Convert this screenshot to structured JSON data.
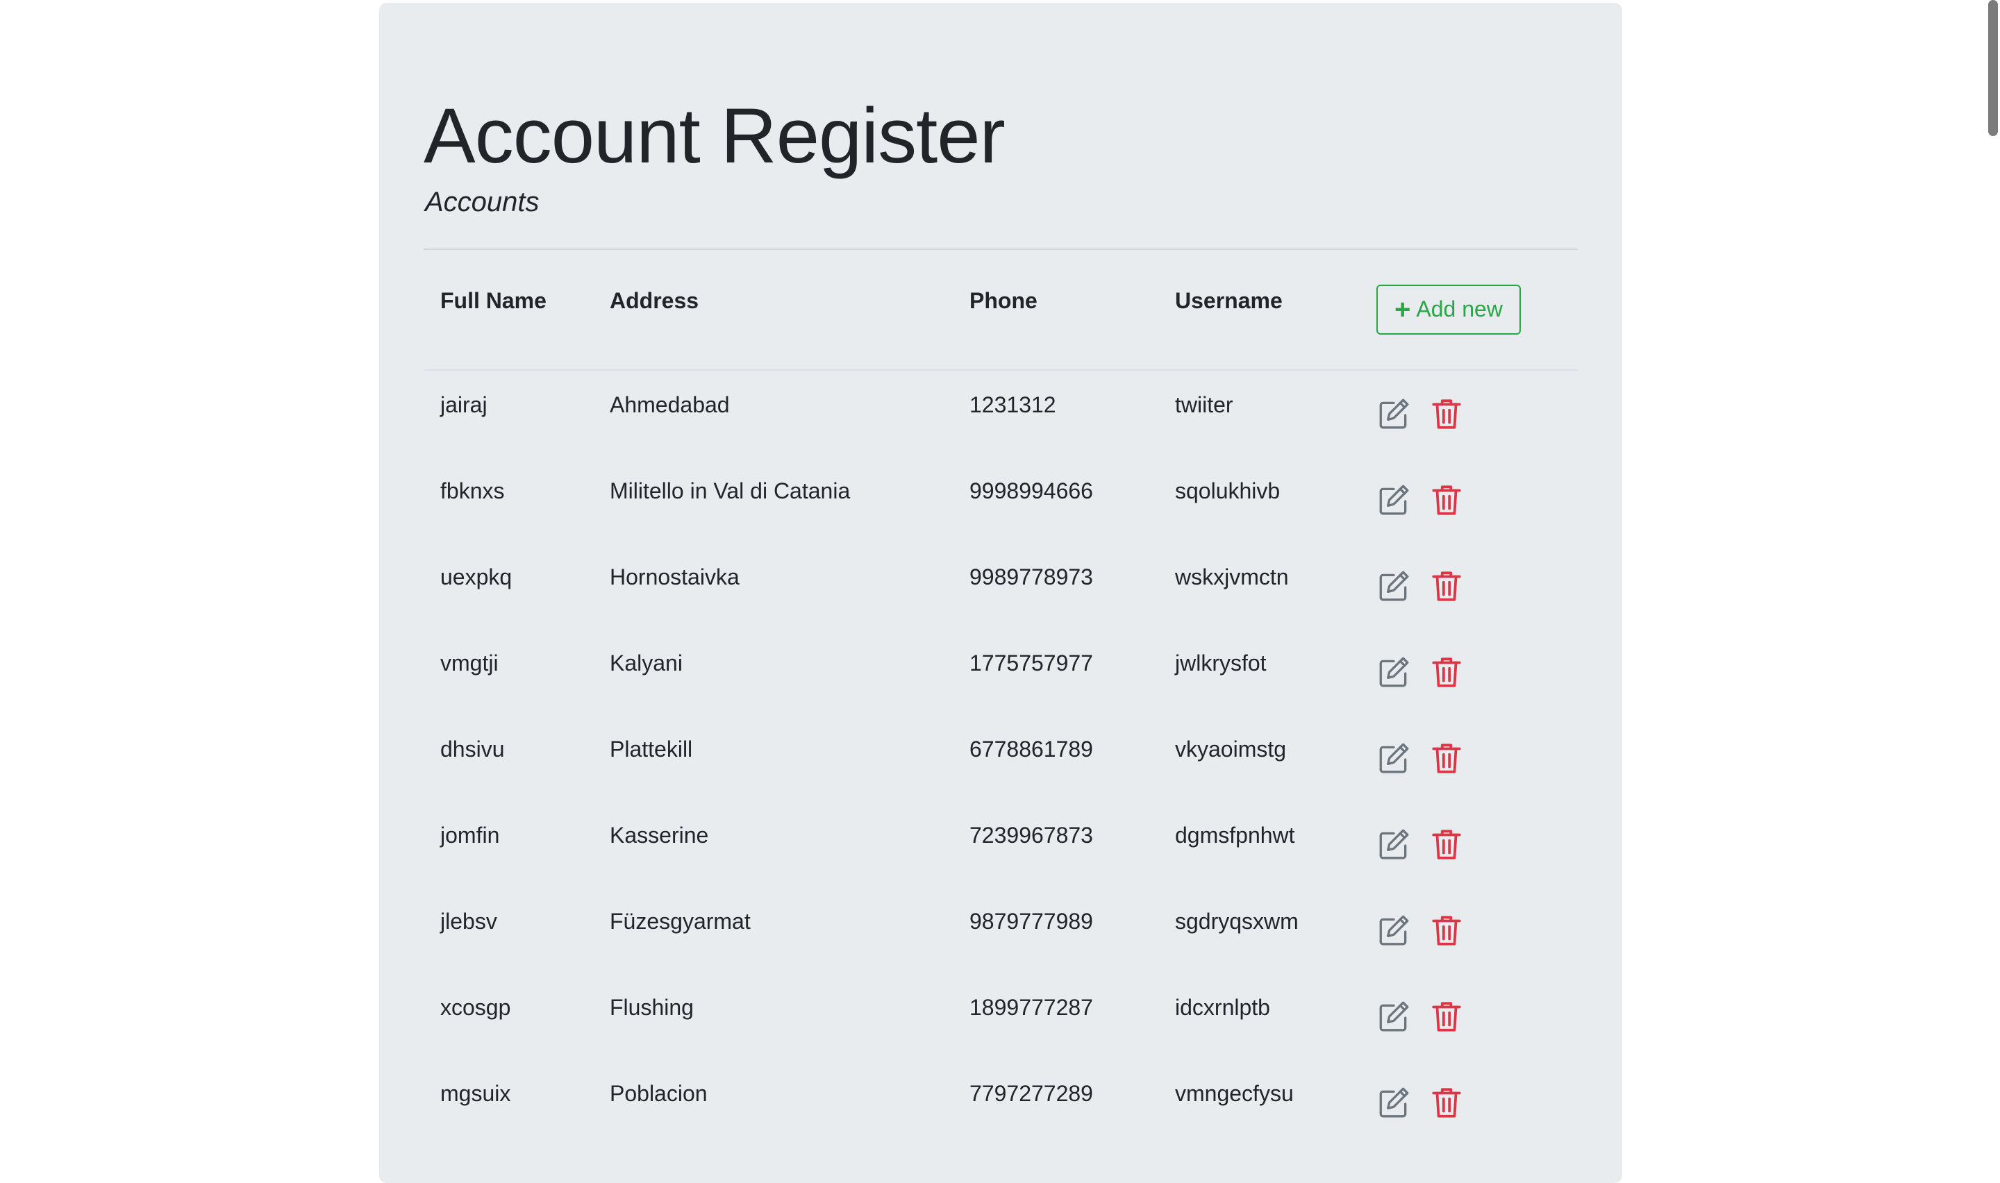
{
  "page": {
    "title": "Account Register",
    "subtitle": "Accounts"
  },
  "table": {
    "headers": {
      "full_name": "Full Name",
      "address": "Address",
      "phone": "Phone",
      "username": "Username"
    },
    "add_button": {
      "icon": "plus-icon",
      "label": "Add new"
    },
    "rows": [
      {
        "full_name": "jairaj",
        "address": "Ahmedabad",
        "phone": "1231312",
        "username": "twiiter"
      },
      {
        "full_name": "fbknxs",
        "address": "Militello in Val di Catania",
        "phone": "9998994666",
        "username": "sqolukhivb"
      },
      {
        "full_name": "uexpkq",
        "address": "Hornostaivka",
        "phone": "9989778973",
        "username": "wskxjvmctn"
      },
      {
        "full_name": "vmgtji",
        "address": "Kalyani",
        "phone": "1775757977",
        "username": "jwlkrysfot"
      },
      {
        "full_name": "dhsivu",
        "address": "Plattekill",
        "phone": "6778861789",
        "username": "vkyaoimstg"
      },
      {
        "full_name": "jomfin",
        "address": "Kasserine",
        "phone": "7239967873",
        "username": "dgmsfpnhwt"
      },
      {
        "full_name": "jlebsv",
        "address": "Füzesgyarmat",
        "phone": "9879777989",
        "username": "sgdryqsxwm"
      },
      {
        "full_name": "xcosgp",
        "address": "Flushing",
        "phone": "1899777287",
        "username": "idcxrnlptb"
      },
      {
        "full_name": "mgsuix",
        "address": "Poblacion",
        "phone": "7797277289",
        "username": "vmngecfysu"
      }
    ],
    "row_actions": {
      "edit_icon": "edit-icon",
      "delete_icon": "trash-icon"
    }
  },
  "colors": {
    "background": "#e9ecef",
    "add_button": "#28a745",
    "edit_icon": "#6c757d",
    "delete_icon": "#dc3545",
    "text": "#212529"
  }
}
